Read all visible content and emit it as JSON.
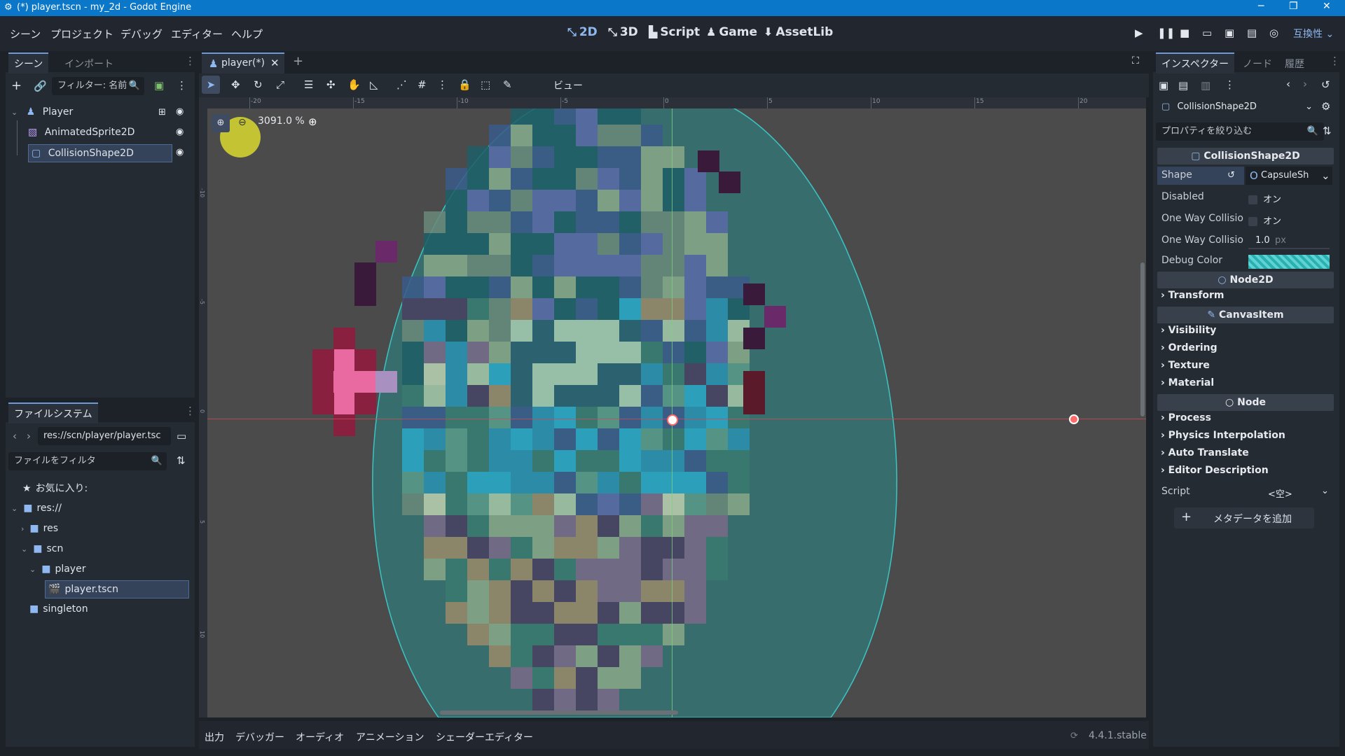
{
  "window": {
    "title": "(*) player.tscn - my_2d - Godot Engine",
    "minimize": "─",
    "maximize": "❐",
    "close": "✕"
  },
  "menu": [
    "シーン",
    "プロジェクト",
    "デバッグ",
    "エディター",
    "ヘルプ"
  ],
  "workspaces": [
    {
      "label": "2D",
      "glyph": "⤡"
    },
    {
      "label": "3D",
      "glyph": "⤡"
    },
    {
      "label": "Script",
      "glyph": "▙"
    },
    {
      "label": "Game",
      "glyph": "♟"
    },
    {
      "label": "AssetLib",
      "glyph": "⬇"
    }
  ],
  "renderer": "互換性",
  "scene_panel": {
    "tabs": [
      "シーン",
      "インポート"
    ],
    "filter_placeholder": "フィルター: 名前",
    "nodes": [
      {
        "label": "Player"
      },
      {
        "label": "AnimatedSprite2D"
      },
      {
        "label": "CollisionShape2D"
      }
    ]
  },
  "filesystem": {
    "tab": "ファイルシステム",
    "path": "res://scn/player/player.tsc",
    "filter_placeholder": "ファイルをフィルタ",
    "items": [
      {
        "label": "お気に入り:"
      },
      {
        "label": "res://"
      },
      {
        "label": "res"
      },
      {
        "label": "scn"
      },
      {
        "label": "player"
      },
      {
        "label": "player.tscn"
      },
      {
        "label": "singleton"
      }
    ]
  },
  "editor_tab": "player(*)",
  "toolbar_view": "ビュー",
  "zoom": "3091.0 %",
  "ruler_labels": [
    "-20",
    "-15",
    "-10",
    "-5",
    "0",
    "5",
    "10",
    "15",
    "20"
  ],
  "vruler_labels": [
    "-10",
    "-5",
    "0",
    "5",
    "10"
  ],
  "bottom_tabs": [
    "出力",
    "デバッガー",
    "オーディオ",
    "アニメーション",
    "シェーダーエディター"
  ],
  "version": "4.4.1.stable",
  "inspector": {
    "tabs": [
      "インスペクター",
      "ノード",
      "履歴"
    ],
    "node_name": "CollisionShape2D",
    "filter_placeholder": "プロパティを絞り込む",
    "section_title": "CollisionShape2D",
    "props": {
      "shape": {
        "key": "Shape",
        "value": "CapsuleSh"
      },
      "disabled": {
        "key": "Disabled",
        "value": "オン"
      },
      "one_way": {
        "key": "One Way Collisio",
        "value": "オン"
      },
      "one_way_margin": {
        "key": "One Way Collisio",
        "value": "1.0",
        "unit": "px"
      },
      "debug_color": {
        "key": "Debug Color"
      }
    },
    "node2d": "Node2D",
    "transform": "Transform",
    "canvasitem": "CanvasItem",
    "canvas_cats": [
      "Visibility",
      "Ordering",
      "Texture",
      "Material"
    ],
    "node": "Node",
    "node_cats": [
      "Process",
      "Physics Interpolation",
      "Auto Translate",
      "Editor Description"
    ],
    "script": {
      "key": "Script",
      "value": "<空>"
    },
    "add_meta": "メタデータを追加"
  },
  "colors": {
    "accent": "#0a77c9",
    "selected": "#34435a",
    "capsule": "#2a8a8a"
  }
}
